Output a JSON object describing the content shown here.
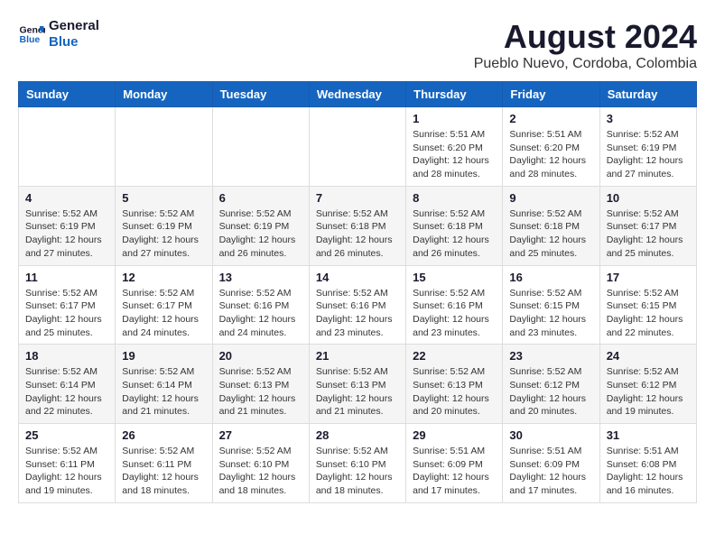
{
  "logo": {
    "line1": "General",
    "line2": "Blue"
  },
  "header": {
    "month": "August 2024",
    "location": "Pueblo Nuevo, Cordoba, Colombia"
  },
  "weekdays": [
    "Sunday",
    "Monday",
    "Tuesday",
    "Wednesday",
    "Thursday",
    "Friday",
    "Saturday"
  ],
  "weeks": [
    [
      {
        "day": "",
        "info": ""
      },
      {
        "day": "",
        "info": ""
      },
      {
        "day": "",
        "info": ""
      },
      {
        "day": "",
        "info": ""
      },
      {
        "day": "1",
        "info": "Sunrise: 5:51 AM\nSunset: 6:20 PM\nDaylight: 12 hours\nand 28 minutes."
      },
      {
        "day": "2",
        "info": "Sunrise: 5:51 AM\nSunset: 6:20 PM\nDaylight: 12 hours\nand 28 minutes."
      },
      {
        "day": "3",
        "info": "Sunrise: 5:52 AM\nSunset: 6:19 PM\nDaylight: 12 hours\nand 27 minutes."
      }
    ],
    [
      {
        "day": "4",
        "info": "Sunrise: 5:52 AM\nSunset: 6:19 PM\nDaylight: 12 hours\nand 27 minutes."
      },
      {
        "day": "5",
        "info": "Sunrise: 5:52 AM\nSunset: 6:19 PM\nDaylight: 12 hours\nand 27 minutes."
      },
      {
        "day": "6",
        "info": "Sunrise: 5:52 AM\nSunset: 6:19 PM\nDaylight: 12 hours\nand 26 minutes."
      },
      {
        "day": "7",
        "info": "Sunrise: 5:52 AM\nSunset: 6:18 PM\nDaylight: 12 hours\nand 26 minutes."
      },
      {
        "day": "8",
        "info": "Sunrise: 5:52 AM\nSunset: 6:18 PM\nDaylight: 12 hours\nand 26 minutes."
      },
      {
        "day": "9",
        "info": "Sunrise: 5:52 AM\nSunset: 6:18 PM\nDaylight: 12 hours\nand 25 minutes."
      },
      {
        "day": "10",
        "info": "Sunrise: 5:52 AM\nSunset: 6:17 PM\nDaylight: 12 hours\nand 25 minutes."
      }
    ],
    [
      {
        "day": "11",
        "info": "Sunrise: 5:52 AM\nSunset: 6:17 PM\nDaylight: 12 hours\nand 25 minutes."
      },
      {
        "day": "12",
        "info": "Sunrise: 5:52 AM\nSunset: 6:17 PM\nDaylight: 12 hours\nand 24 minutes."
      },
      {
        "day": "13",
        "info": "Sunrise: 5:52 AM\nSunset: 6:16 PM\nDaylight: 12 hours\nand 24 minutes."
      },
      {
        "day": "14",
        "info": "Sunrise: 5:52 AM\nSunset: 6:16 PM\nDaylight: 12 hours\nand 23 minutes."
      },
      {
        "day": "15",
        "info": "Sunrise: 5:52 AM\nSunset: 6:16 PM\nDaylight: 12 hours\nand 23 minutes."
      },
      {
        "day": "16",
        "info": "Sunrise: 5:52 AM\nSunset: 6:15 PM\nDaylight: 12 hours\nand 23 minutes."
      },
      {
        "day": "17",
        "info": "Sunrise: 5:52 AM\nSunset: 6:15 PM\nDaylight: 12 hours\nand 22 minutes."
      }
    ],
    [
      {
        "day": "18",
        "info": "Sunrise: 5:52 AM\nSunset: 6:14 PM\nDaylight: 12 hours\nand 22 minutes."
      },
      {
        "day": "19",
        "info": "Sunrise: 5:52 AM\nSunset: 6:14 PM\nDaylight: 12 hours\nand 21 minutes."
      },
      {
        "day": "20",
        "info": "Sunrise: 5:52 AM\nSunset: 6:13 PM\nDaylight: 12 hours\nand 21 minutes."
      },
      {
        "day": "21",
        "info": "Sunrise: 5:52 AM\nSunset: 6:13 PM\nDaylight: 12 hours\nand 21 minutes."
      },
      {
        "day": "22",
        "info": "Sunrise: 5:52 AM\nSunset: 6:13 PM\nDaylight: 12 hours\nand 20 minutes."
      },
      {
        "day": "23",
        "info": "Sunrise: 5:52 AM\nSunset: 6:12 PM\nDaylight: 12 hours\nand 20 minutes."
      },
      {
        "day": "24",
        "info": "Sunrise: 5:52 AM\nSunset: 6:12 PM\nDaylight: 12 hours\nand 19 minutes."
      }
    ],
    [
      {
        "day": "25",
        "info": "Sunrise: 5:52 AM\nSunset: 6:11 PM\nDaylight: 12 hours\nand 19 minutes."
      },
      {
        "day": "26",
        "info": "Sunrise: 5:52 AM\nSunset: 6:11 PM\nDaylight: 12 hours\nand 18 minutes."
      },
      {
        "day": "27",
        "info": "Sunrise: 5:52 AM\nSunset: 6:10 PM\nDaylight: 12 hours\nand 18 minutes."
      },
      {
        "day": "28",
        "info": "Sunrise: 5:52 AM\nSunset: 6:10 PM\nDaylight: 12 hours\nand 18 minutes."
      },
      {
        "day": "29",
        "info": "Sunrise: 5:51 AM\nSunset: 6:09 PM\nDaylight: 12 hours\nand 17 minutes."
      },
      {
        "day": "30",
        "info": "Sunrise: 5:51 AM\nSunset: 6:09 PM\nDaylight: 12 hours\nand 17 minutes."
      },
      {
        "day": "31",
        "info": "Sunrise: 5:51 AM\nSunset: 6:08 PM\nDaylight: 12 hours\nand 16 minutes."
      }
    ]
  ]
}
